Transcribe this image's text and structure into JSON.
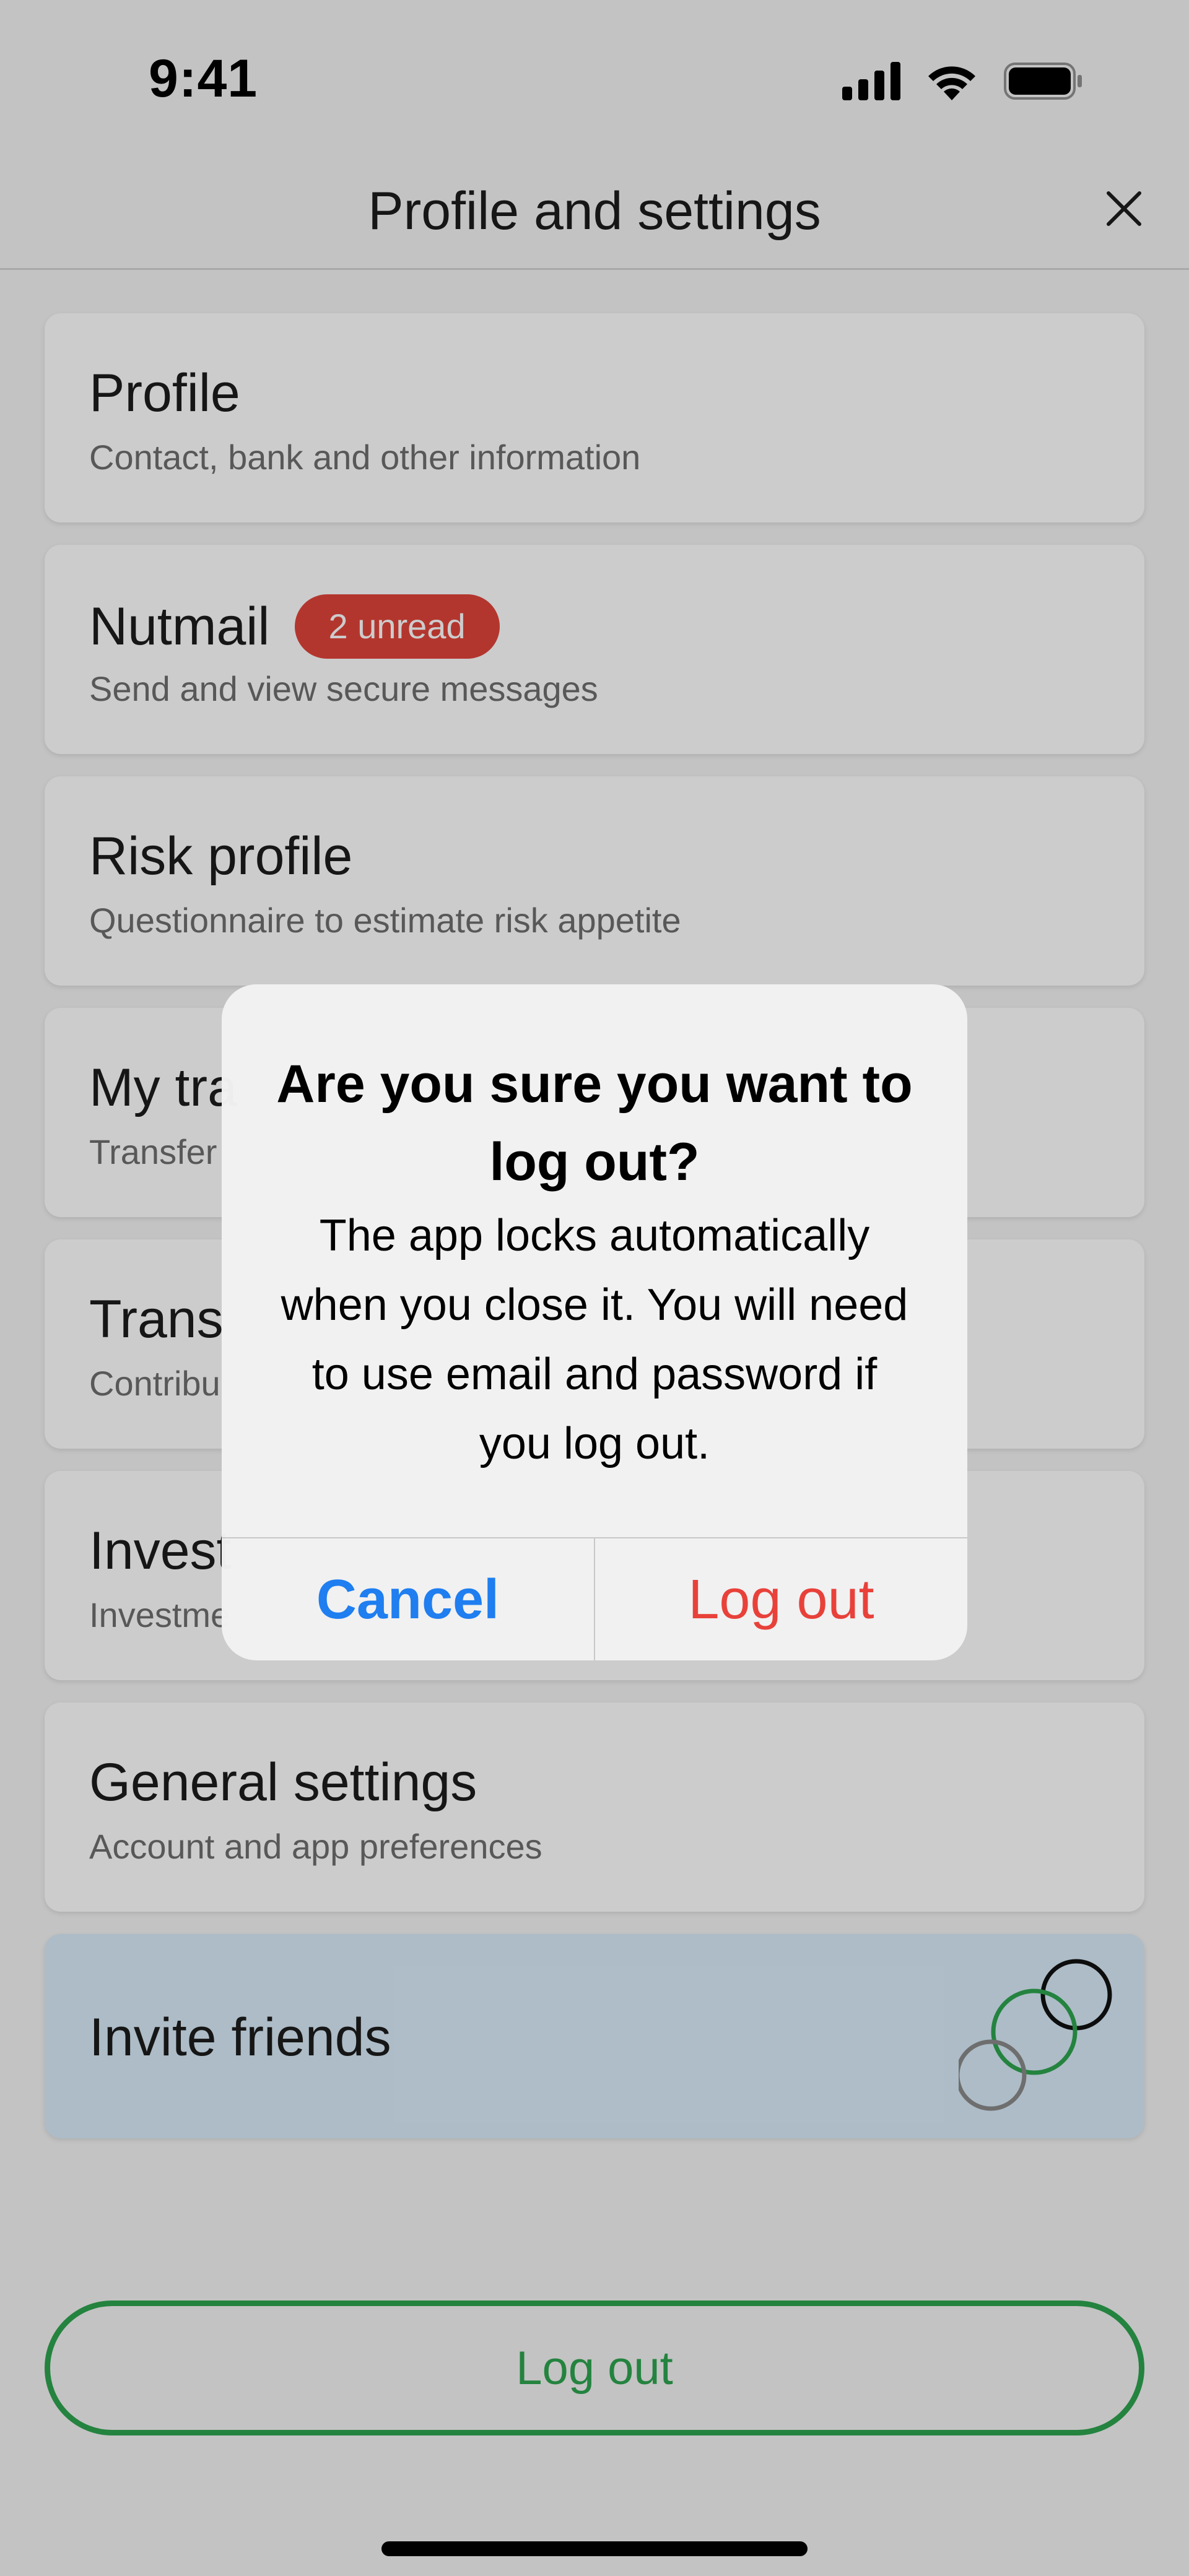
{
  "status_bar": {
    "time": "9:41"
  },
  "header": {
    "title": "Profile and settings"
  },
  "menu": {
    "items": [
      {
        "title": "Profile",
        "subtitle": "Contact, bank and other information"
      },
      {
        "title": "Nutmail",
        "subtitle": "Send and view secure messages",
        "badge": "2 unread"
      },
      {
        "title": "Risk profile",
        "subtitle": "Questionnaire to estimate risk appetite"
      },
      {
        "title": "My tra",
        "subtitle": "Transfer"
      },
      {
        "title": "Trans",
        "subtitle": "Contribu"
      },
      {
        "title": "Invest",
        "subtitle": "Investme"
      },
      {
        "title": "General settings",
        "subtitle": "Account and app preferences"
      }
    ],
    "invite": {
      "title": "Invite friends"
    }
  },
  "logout_button": {
    "label": "Log out"
  },
  "alert": {
    "title": "Are you sure you want to log out?",
    "message": "The app locks automatically when you close it. You will need to use email and password if you log out.",
    "cancel_label": "Cancel",
    "confirm_label": "Log out"
  },
  "colors": {
    "accent_green": "#2ea44f",
    "badge_red": "#e0443a",
    "alert_blue": "#1f7ef0",
    "alert_red": "#e8413a",
    "invite_bg": "#d9ecf9"
  },
  "icons": {
    "close": "close-icon",
    "signal": "cellular-signal-icon",
    "wifi": "wifi-icon",
    "battery": "battery-icon",
    "invite": "invite-circles-icon"
  }
}
